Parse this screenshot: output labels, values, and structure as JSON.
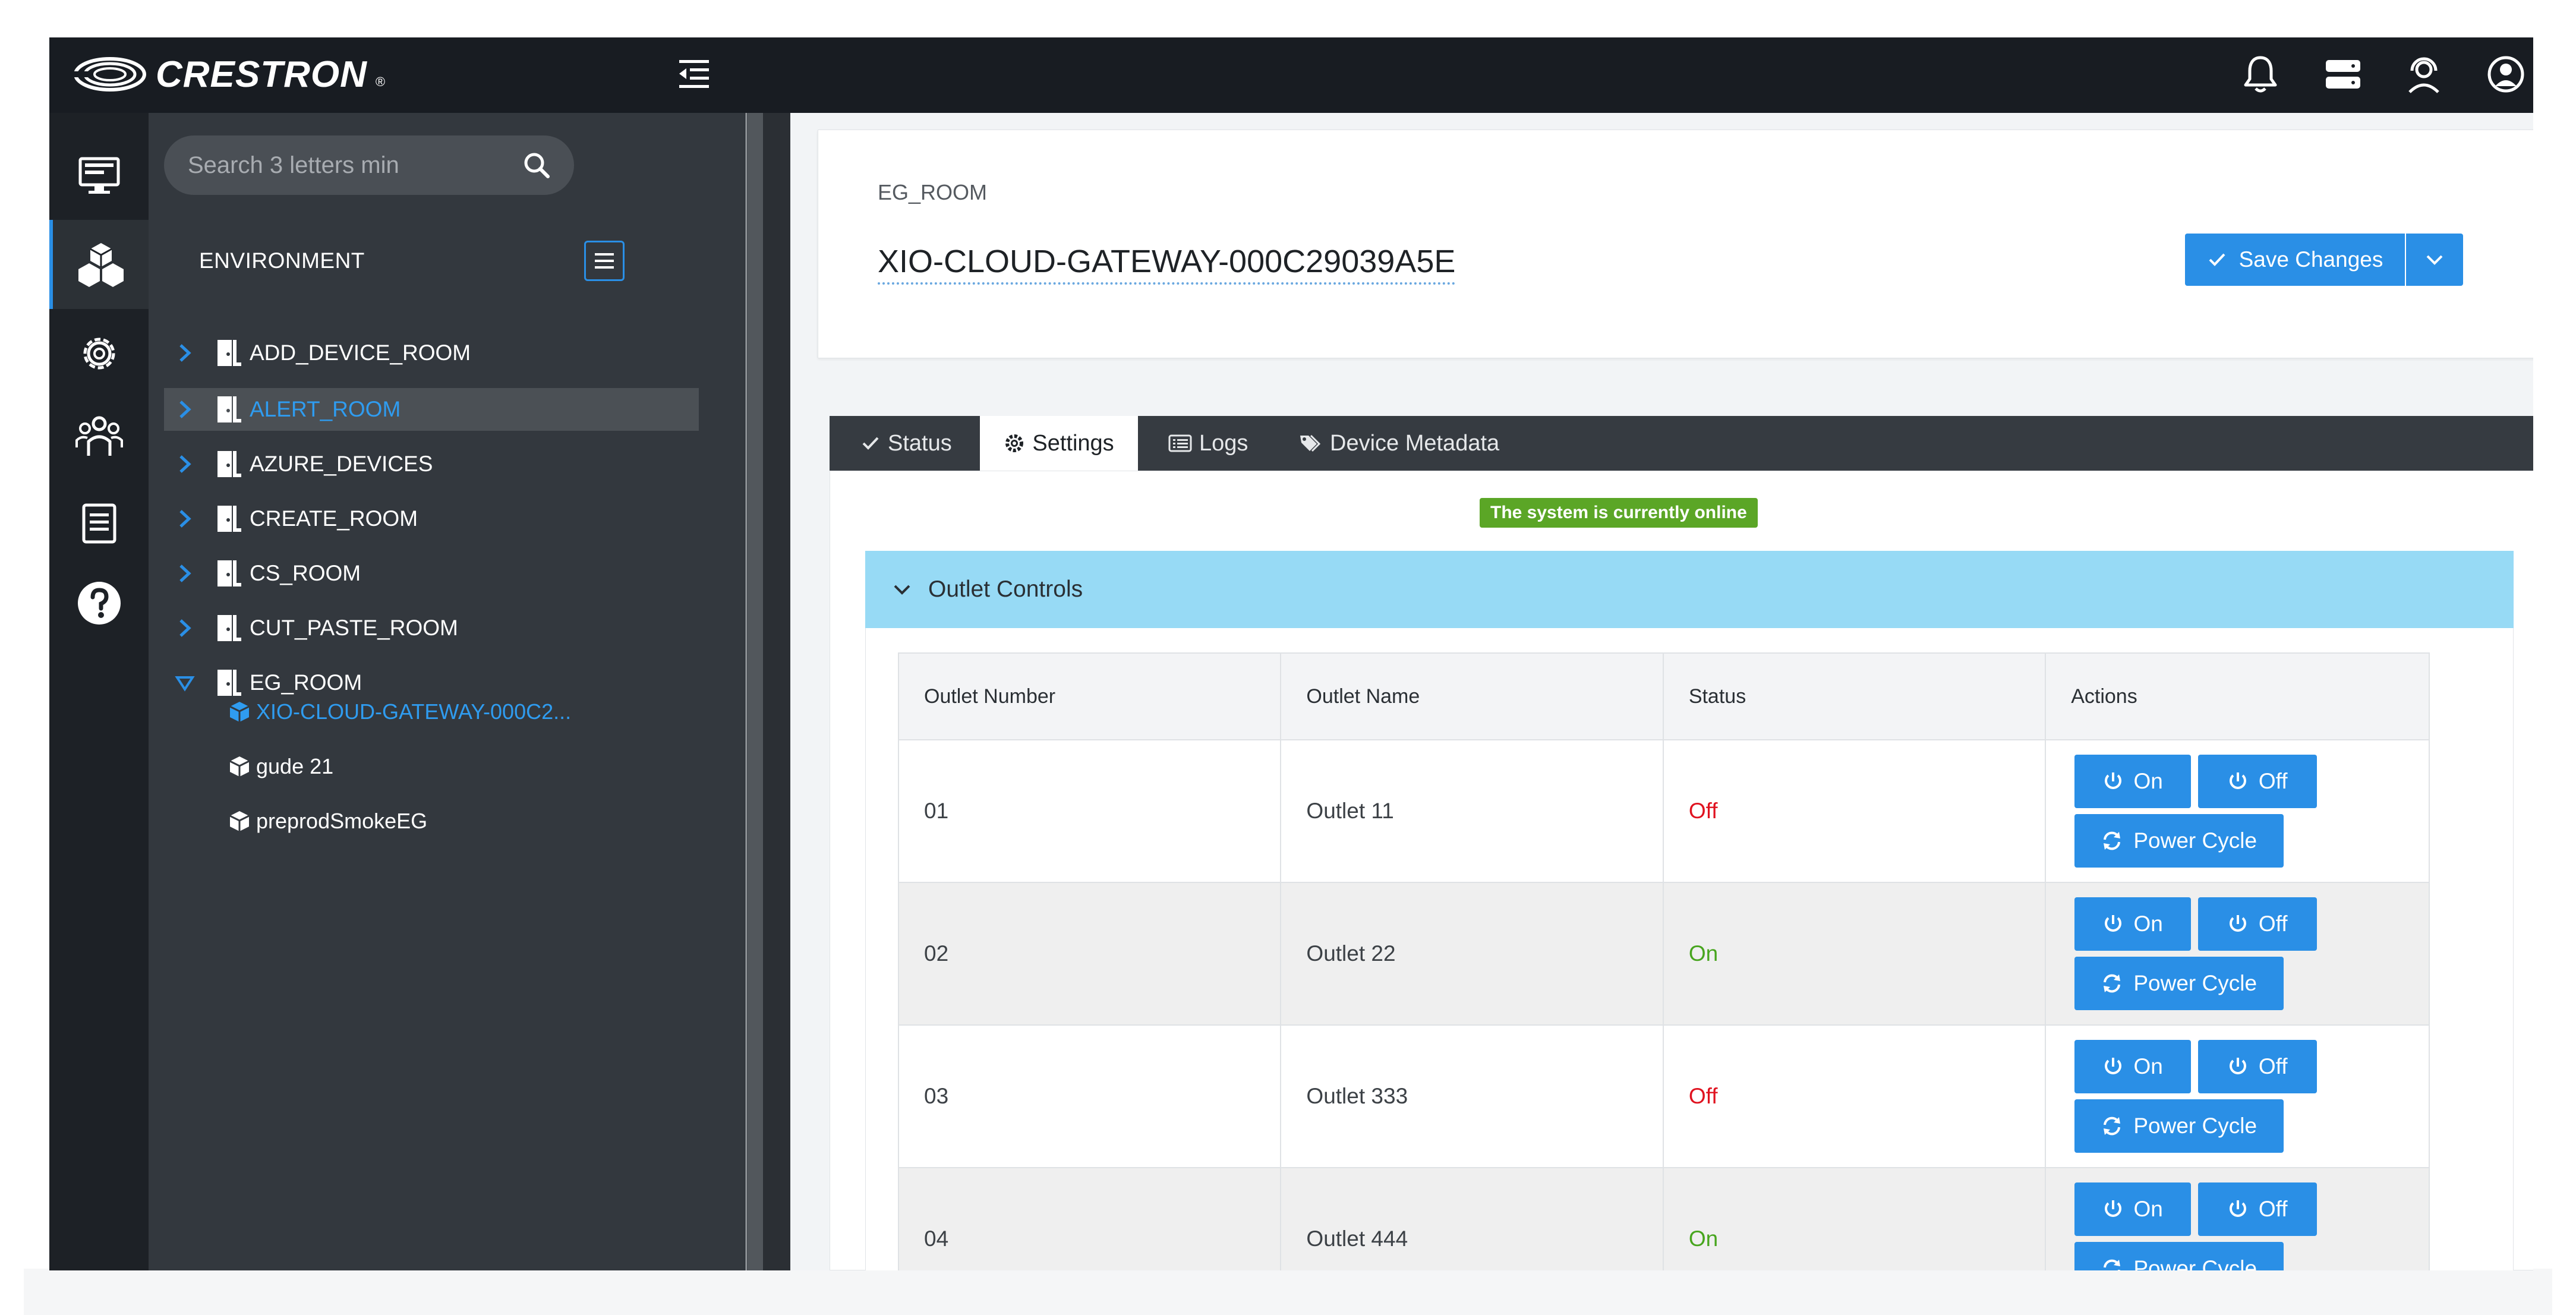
{
  "header": {
    "brand": "CRESTRON",
    "brand_mark": "®"
  },
  "icons": {
    "brand": "crestron-swirl-icon",
    "collapse": "collapse-sidebar-icon",
    "notifications": "bell-icon",
    "servers": "server-icon",
    "support": "headset-icon",
    "account": "user-circle-icon",
    "rail": [
      "monitor-icon",
      "cubes-icon",
      "gear-icon",
      "users-icon",
      "clipboard-icon",
      "help-icon"
    ],
    "search": "search-icon",
    "room": "door-icon",
    "device": "cube-icon"
  },
  "sidebar": {
    "search_placeholder": "Search 3 letters min",
    "environment_label": "ENVIRONMENT",
    "rooms": [
      {
        "label": "ADD_DEVICE_ROOM"
      },
      {
        "label": "ALERT_ROOM"
      },
      {
        "label": "AZURE_DEVICES"
      },
      {
        "label": "CREATE_ROOM"
      },
      {
        "label": "CS_ROOM"
      },
      {
        "label": "CUT_PASTE_ROOM"
      },
      {
        "label": "EG_ROOM"
      }
    ],
    "devices": [
      {
        "label": "XIO-CLOUD-GATEWAY-000C2..."
      },
      {
        "label": "gude 21"
      },
      {
        "label": "preprodSmokeEG"
      }
    ]
  },
  "main": {
    "breadcrumb": "EG_ROOM",
    "device_title": "XIO-CLOUD-GATEWAY-000C29039A5E",
    "save_label": "Save Changes",
    "tabs": [
      {
        "label": "Status"
      },
      {
        "label": "Settings"
      },
      {
        "label": "Logs"
      },
      {
        "label": "Device Metadata"
      }
    ],
    "online_status": "The system is currently online",
    "section_title": "Outlet Controls",
    "columns": [
      "Outlet Number",
      "Outlet Name",
      "Status",
      "Actions"
    ],
    "outlets": [
      {
        "number": "01",
        "name": "Outlet 11",
        "status": "Off"
      },
      {
        "number": "02",
        "name": "Outlet 22",
        "status": "On"
      },
      {
        "number": "03",
        "name": "Outlet 333",
        "status": "Off"
      },
      {
        "number": "04",
        "name": "Outlet 444",
        "status": "On"
      }
    ],
    "actions": {
      "on": "On",
      "off": "Off",
      "cycle": "Power Cycle"
    }
  },
  "colors": {
    "accent": "#2a8fe6",
    "topbar": "#181c22",
    "status_on": "#47a51e",
    "status_off": "#e0121f",
    "online_badge": "#5ba626",
    "section_header": "#97daf5"
  }
}
